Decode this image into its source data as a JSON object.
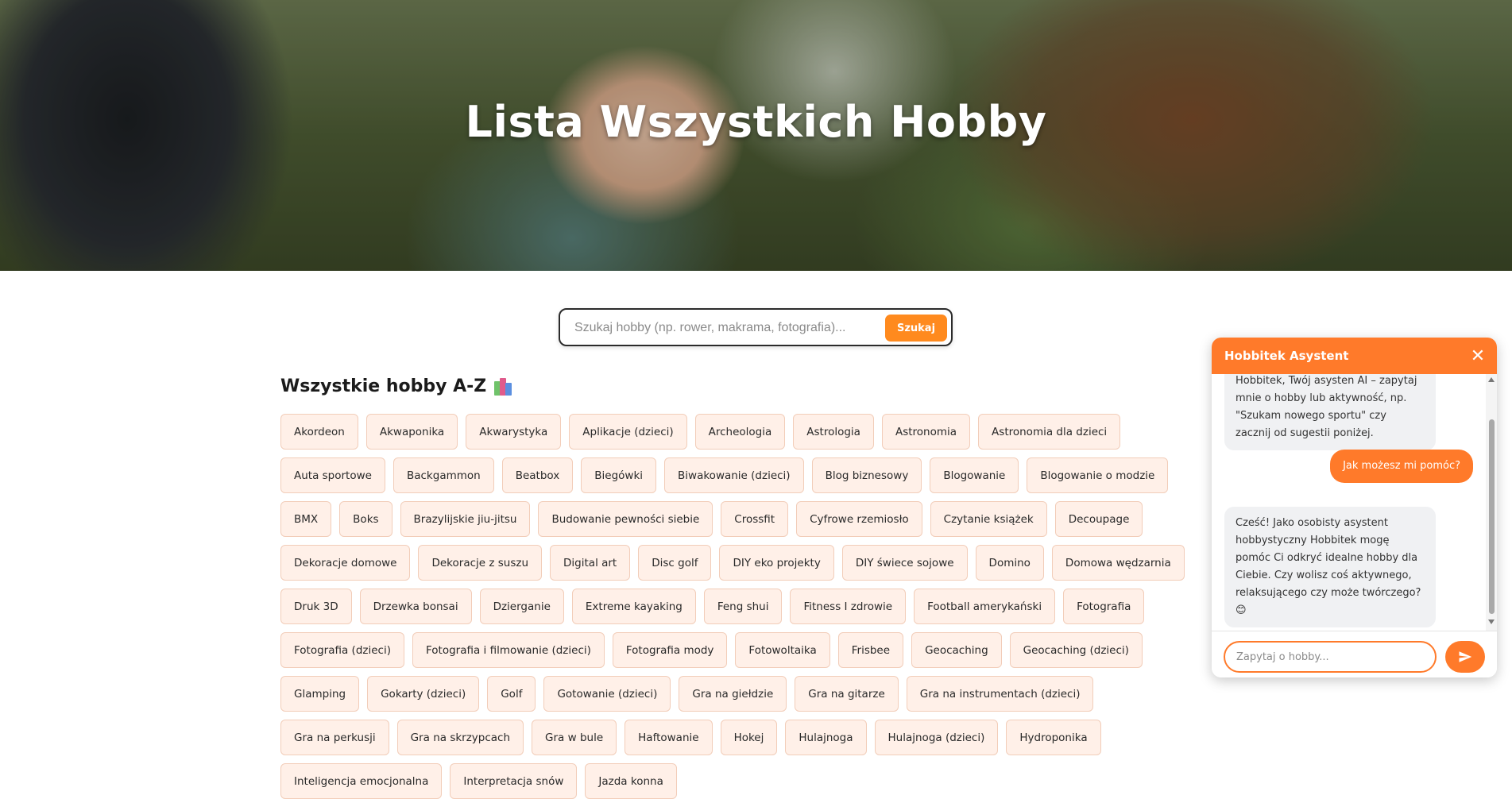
{
  "hero": {
    "title": "Lista Wszystkich Hobby"
  },
  "search": {
    "placeholder": "Szukaj hobby (np. rower, makrama, fotografia)...",
    "button_label": "Szukaj"
  },
  "section": {
    "title": "Wszystkie hobby A-Z",
    "icon": "books-icon"
  },
  "hobbies": [
    "Akordeon",
    "Akwaponika",
    "Akwarystyka",
    "Aplikacje (dzieci)",
    "Archeologia",
    "Astrologia",
    "Astronomia",
    "Astronomia dla dzieci",
    "Auta sportowe",
    "Backgammon",
    "Beatbox",
    "Biegówki",
    "Biwakowanie (dzieci)",
    "Blog biznesowy",
    "Blogowanie",
    "Blogowanie o modzie",
    "BMX",
    "Boks",
    "Brazylijskie jiu-jitsu",
    "Budowanie pewności siebie",
    "Crossfit",
    "Cyfrowe rzemiosło",
    "Czytanie książek",
    "Decoupage",
    "Dekoracje domowe",
    "Dekoracje z suszu",
    "Digital art",
    "Disc golf",
    "DIY eko projekty",
    "DIY świece sojowe",
    "Domino",
    "Domowa wędzarnia",
    "Druk 3D",
    "Drzewka bonsai",
    "Dzierganie",
    "Extreme kayaking",
    "Feng shui",
    "Fitness I zdrowie",
    "Football amerykański",
    "Fotografia",
    "Fotografia (dzieci)",
    "Fotografia i filmowanie (dzieci)",
    "Fotografia mody",
    "Fotowoltaika",
    "Frisbee",
    "Geocaching",
    "Geocaching (dzieci)",
    "Glamping",
    "Gokarty (dzieci)",
    "Golf",
    "Gotowanie (dzieci)",
    "Gra na giełdzie",
    "Gra na gitarze",
    "Gra na instrumentach (dzieci)",
    "Gra na perkusji",
    "Gra na skrzypcach",
    "Gra w bule",
    "Haftowanie",
    "Hokej",
    "Hulajnoga",
    "Hulajnoga (dzieci)",
    "Hydroponika",
    "Inteligencja emocjonalna",
    "Interpretacja snów",
    "Jazda konna"
  ],
  "chat": {
    "title": "Hobbitek Asystent",
    "close_icon": "close-icon",
    "messages": [
      {
        "role": "bot",
        "text": "Hobbitek, Twój asysten AI – zapytaj mnie o hobby lub aktywność, np. \"Szukam nowego sportu\" czy zacznij od sugestii poniżej."
      },
      {
        "role": "user",
        "text": "Jak możesz mi pomóc?"
      },
      {
        "role": "bot",
        "text": "Cześć! Jako osobisty asystent hobbystyczny Hobbitek mogę pomóc Ci odkryć idealne hobby dla Ciebie. Czy wolisz coś aktywnego, relaksującego czy może twórczego? 😊"
      }
    ],
    "input_placeholder": "Zapytaj o hobby...",
    "send_icon": "send-icon"
  },
  "colors": {
    "accent": "#ff7a2a",
    "search_button": "#ff8a1e",
    "tag_bg": "#fff0e8",
    "tag_border": "#f2cdb9"
  }
}
